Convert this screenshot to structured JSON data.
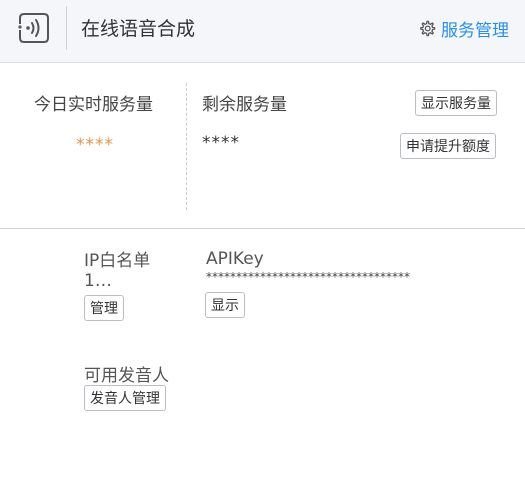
{
  "header": {
    "title": "在线语音合成",
    "service_manage_label": "服务管理"
  },
  "stats": {
    "today_label": "今日实时服务量",
    "today_value": "****",
    "remaining_label": "剩余服务量",
    "remaining_value": "****",
    "show_usage_label": "显示服务量",
    "apply_quota_label": "申请提升额度"
  },
  "keys": {
    "ip_whitelist_label": "IP白名单1…",
    "manage_label": "管理",
    "apikey_label": "APIKey",
    "apikey_value": "**********************************",
    "show_key_label": "显示"
  },
  "speakers": {
    "available_label": "可用发音人",
    "manage_label": "发音人管理"
  },
  "colors": {
    "accent": "#2b8fe6",
    "highlight": "#e8914a",
    "header_bg": "#f4f6fa"
  },
  "icons": {
    "app": "voice-synthesis-icon",
    "settings": "gear-icon"
  }
}
